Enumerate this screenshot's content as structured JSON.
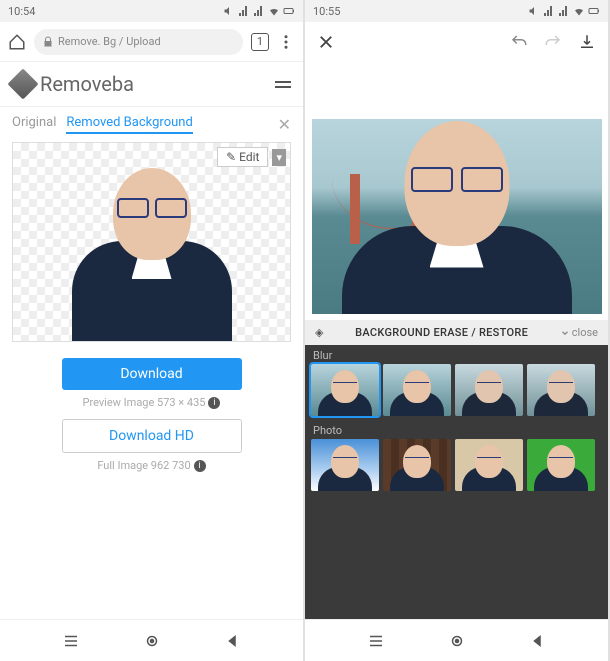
{
  "left": {
    "status_time": "10:54",
    "url": "Remove. Bg / Upload",
    "tab_count": "1",
    "brand": "Removeba",
    "tabs": {
      "original": "Original",
      "removed": "Removed Background"
    },
    "edit_label": "✎ Edit",
    "download_label": "Download",
    "preview_caption": "Preview Image 573 × 435",
    "download_hd_label": "Download HD",
    "full_caption": "Full Image 962 730"
  },
  "right": {
    "status_time": "10:55",
    "panel_title": "BACKGROUND ERASE / RESTORE",
    "panel_close": "close",
    "section_blur": "Blur",
    "section_photo": "Photo"
  }
}
